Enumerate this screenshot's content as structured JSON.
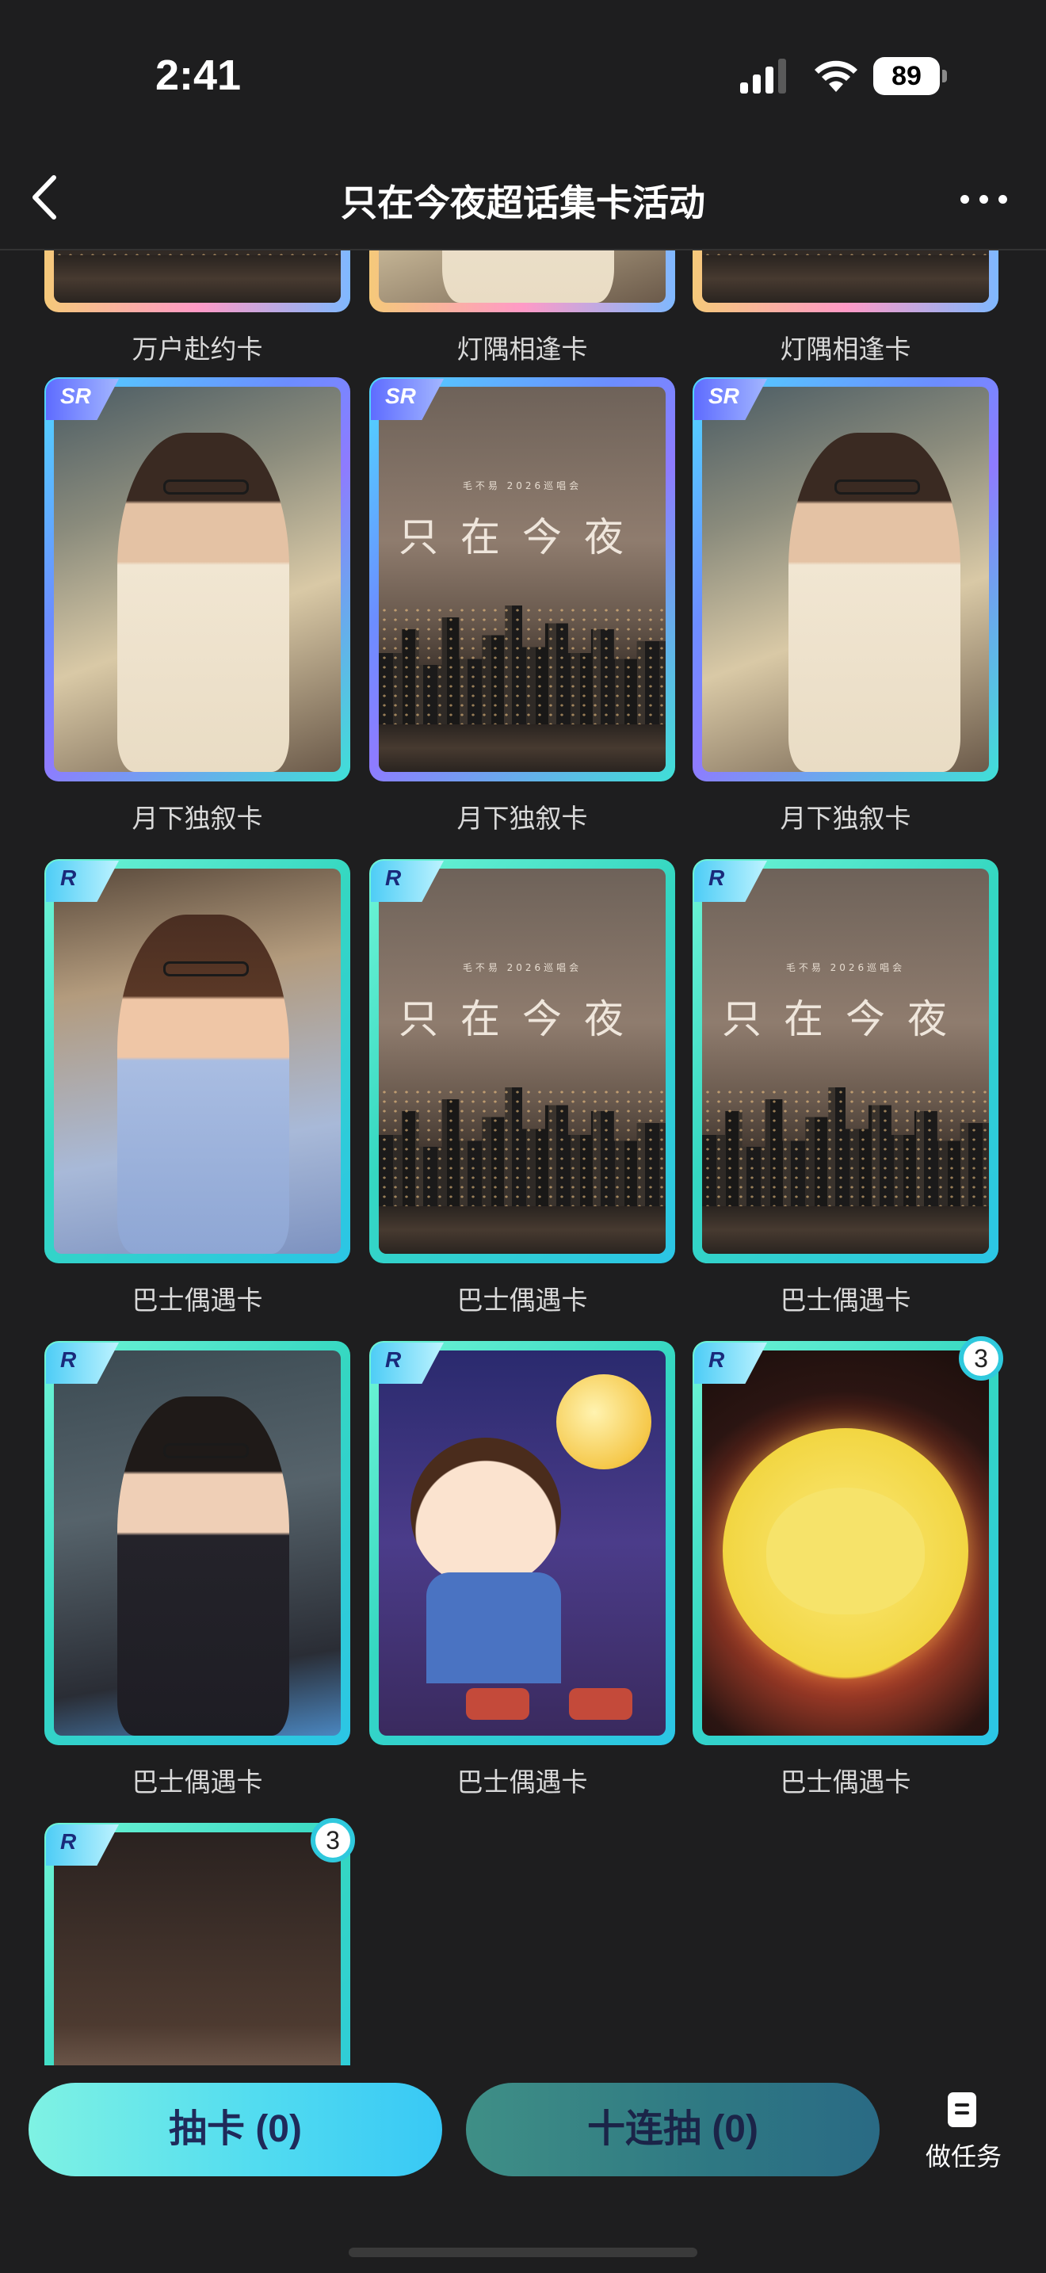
{
  "status_bar": {
    "time": "2:41",
    "battery": "89"
  },
  "header": {
    "title": "只在今夜超话集卡活动"
  },
  "cards": [
    {
      "name": "万户赴约卡",
      "rarity": "",
      "count": ""
    },
    {
      "name": "灯隅相逢卡",
      "rarity": "",
      "count": ""
    },
    {
      "name": "灯隅相逢卡",
      "rarity": "",
      "count": ""
    },
    {
      "name": "月下独叙卡",
      "rarity": "SR",
      "count": ""
    },
    {
      "name": "月下独叙卡",
      "rarity": "SR",
      "count": ""
    },
    {
      "name": "月下独叙卡",
      "rarity": "SR",
      "count": ""
    },
    {
      "name": "巴士偶遇卡",
      "rarity": "R",
      "count": ""
    },
    {
      "name": "巴士偶遇卡",
      "rarity": "R",
      "count": ""
    },
    {
      "name": "巴士偶遇卡",
      "rarity": "R",
      "count": ""
    },
    {
      "name": "巴士偶遇卡",
      "rarity": "R",
      "count": ""
    },
    {
      "name": "巴士偶遇卡",
      "rarity": "R",
      "count": ""
    },
    {
      "name": "巴士偶遇卡",
      "rarity": "R",
      "count": "3"
    },
    {
      "name": "",
      "rarity": "R",
      "count": "3"
    }
  ],
  "poster": {
    "subtitle": "毛不易 2026巡唱会",
    "title": "只在今夜"
  },
  "bottom_bar": {
    "draw_label": "抽卡 (0)",
    "ten_draw_label": "十连抽 (0)",
    "task_label": "做任务"
  },
  "colors": {
    "background": "#1e1e1f",
    "sr_frame": "#6c8dff",
    "r_frame": "#35d7c1",
    "draw_button": "#52dcf0"
  }
}
